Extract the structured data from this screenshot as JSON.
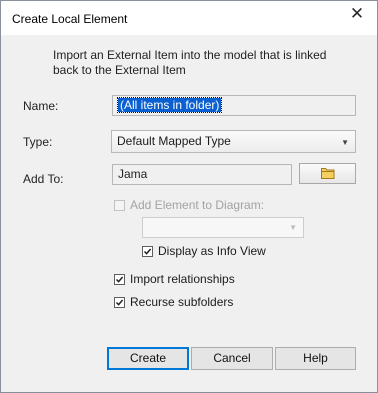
{
  "window": {
    "title": "Create Local Element",
    "close_glyph": "✕"
  },
  "description": "Import an External Item into the model that is linked back to the External Item",
  "fields": {
    "name_label": "Name:",
    "name_value": "(All items in folder)",
    "type_label": "Type:",
    "type_value": "Default Mapped Type",
    "add_to_label": "Add To:",
    "add_to_value": "Jama"
  },
  "checkboxes": {
    "add_to_diagram": {
      "label": "Add Element to Diagram:",
      "checked": false,
      "enabled": false
    },
    "display_info_view": {
      "label": "Display as Info View",
      "checked": true
    },
    "import_relationships": {
      "label": "Import relationships",
      "checked": true
    },
    "recurse_subfolders": {
      "label": "Recurse subfolders",
      "checked": true
    }
  },
  "buttons": {
    "create": "Create",
    "cancel": "Cancel",
    "help": "Help"
  },
  "icons": {
    "close": "close-icon",
    "folder": "folder-icon",
    "dropdown": "chevron-down-icon"
  },
  "colors": {
    "selection": "#0a5fd1",
    "default_button_border": "#0078d7",
    "folder": "#e8b84a"
  }
}
